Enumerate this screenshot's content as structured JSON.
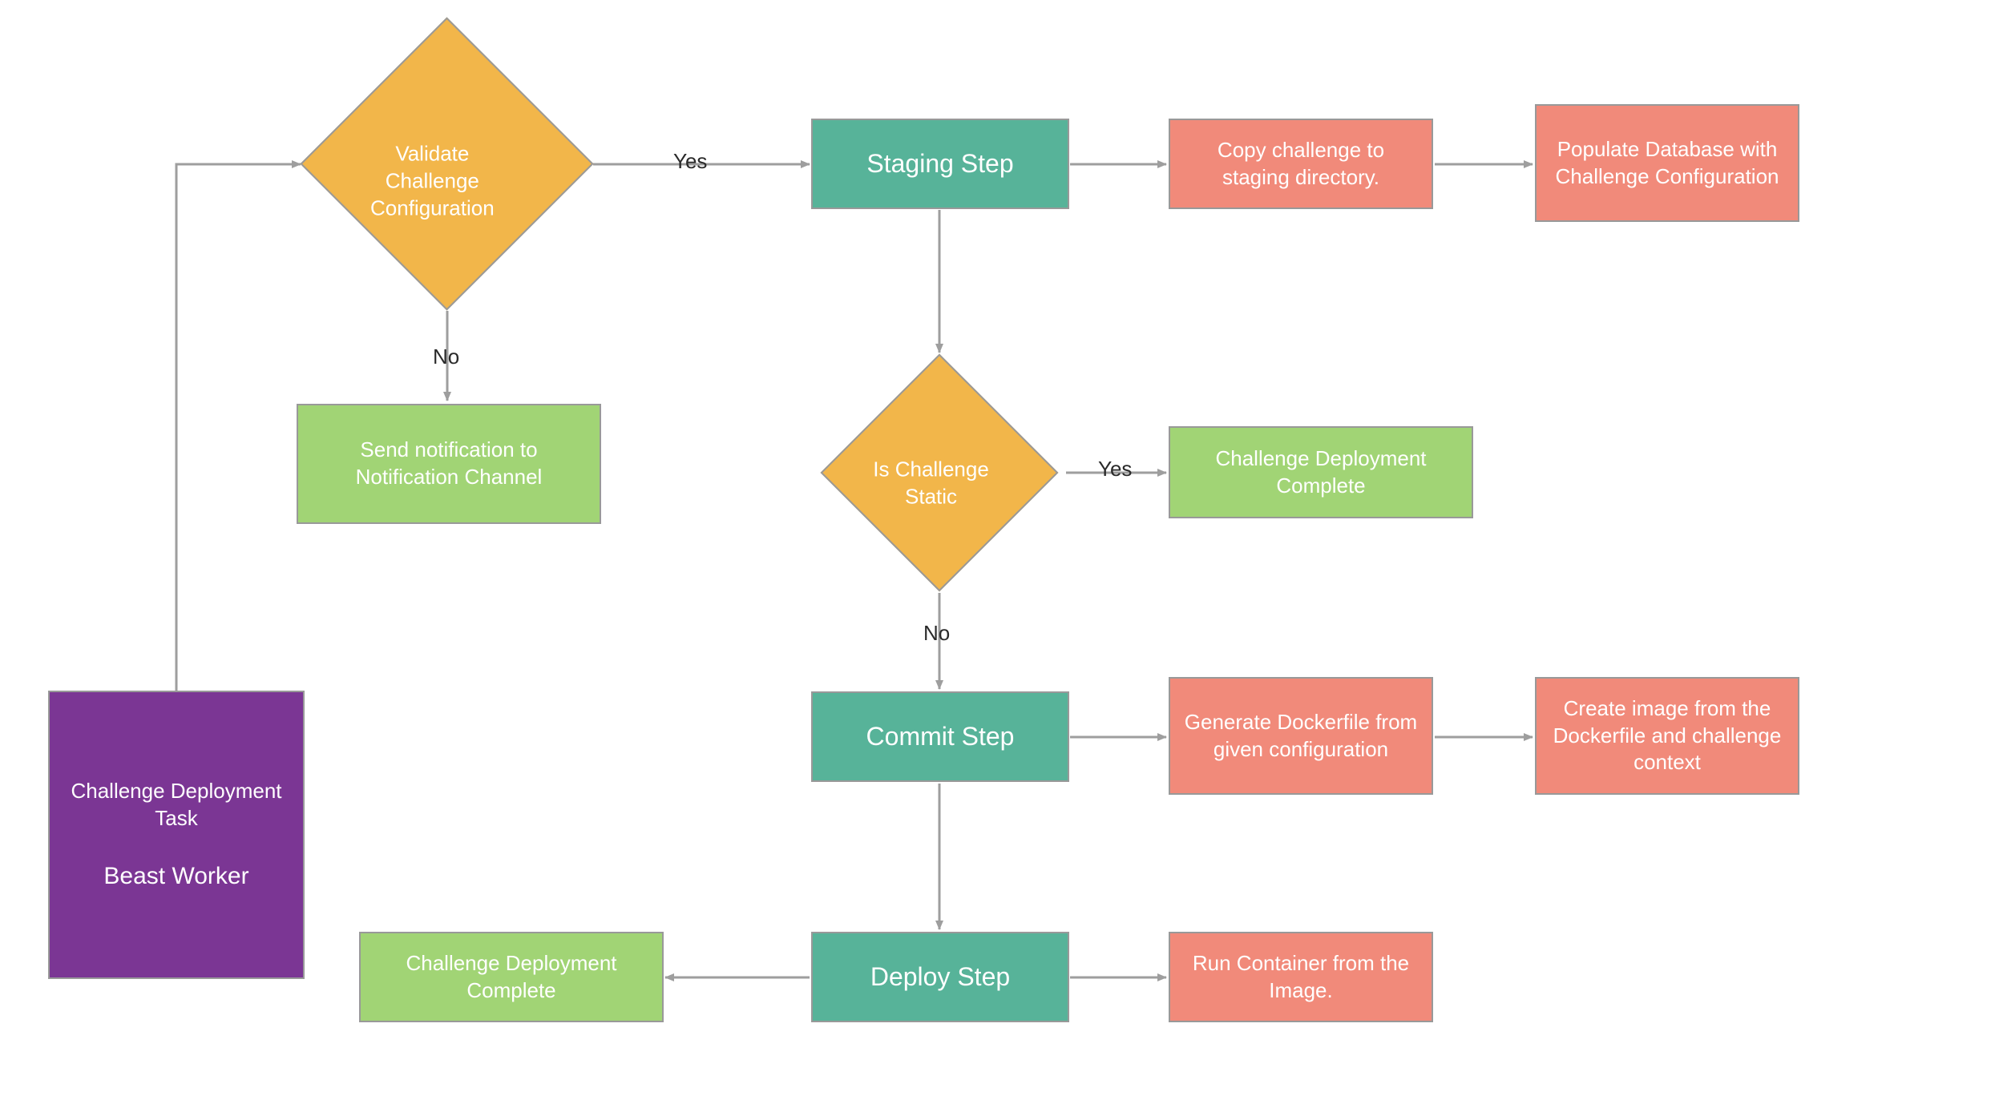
{
  "nodes": {
    "worker": {
      "title": "Challenge Deployment Task",
      "subtitle": "Beast Worker"
    },
    "validate": "Validate Challenge Configuration",
    "sendNotify": "Send notification to Notification Channel",
    "staging": "Staging Step",
    "copyChallenge": "Copy challenge to staging directory.",
    "populateDb": "Populate Database with Challenge Configuration",
    "isStatic": "Is Challenge Static",
    "deployComplete1": "Challenge Deployment Complete",
    "commit": "Commit Step",
    "genDockerfile": "Generate Dockerfile from given configuration",
    "createImage": "Create image from the Dockerfile and challenge context",
    "deploy": "Deploy Step",
    "runContainer": "Run Container from the Image.",
    "deployComplete2": "Challenge Deployment Complete"
  },
  "labels": {
    "yes1": "Yes",
    "no1": "No",
    "yes2": "Yes",
    "no2": "No"
  },
  "colors": {
    "purple": "#7b3694",
    "teal": "#57b399",
    "coral": "#f18a7a",
    "green": "#a1d475",
    "orange": "#f2b64a",
    "arrow": "#9e9e9e"
  }
}
